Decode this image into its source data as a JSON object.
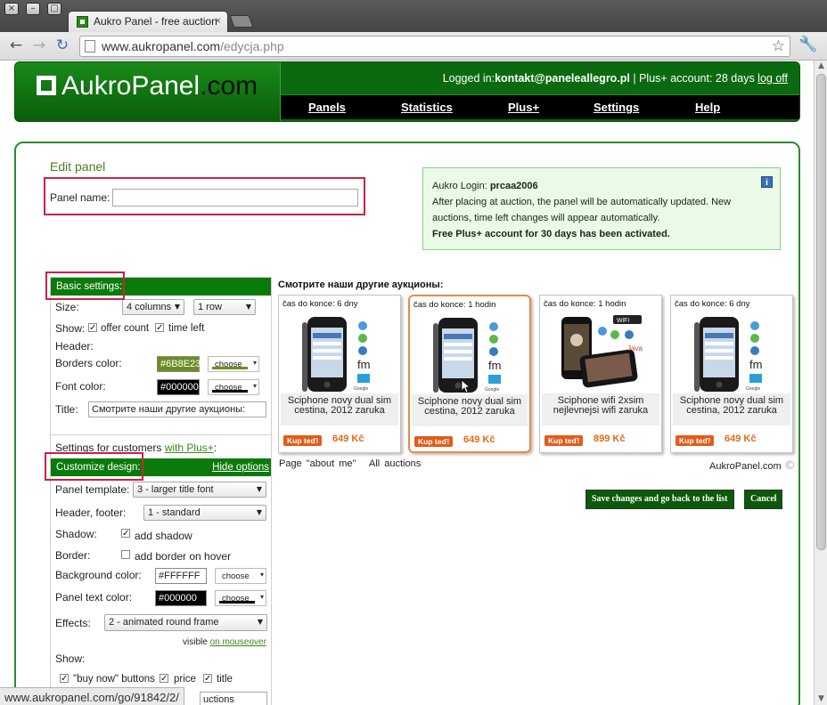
{
  "browser": {
    "tab_title": "Aukro Panel - free auction",
    "tab_close": "×",
    "url_host": "www.aukropanel.com",
    "url_path": "/edycja.php",
    "window_buttons": [
      "×",
      "–",
      "□"
    ],
    "status_url": "www.aukropanel.com/go/91842/2/"
  },
  "header": {
    "logo_main": "AukroPanel",
    "logo_suffix": ".com",
    "logged_in_label": "Logged in:",
    "user_email": "kontakt@paneleallegro.pl",
    "plus_account": " | Plus+ account: 28 days ",
    "logout": "log off",
    "nav": [
      "Panels",
      "Statistics",
      "Plus+",
      "Settings",
      "Help"
    ]
  },
  "edit": {
    "title": "Edit panel",
    "panel_name_label": "Panel name:",
    "panel_name_value": ""
  },
  "info": {
    "login_label": "Aukro Login: ",
    "login_value": "prcaa2006",
    "text": "After placing at auction, the panel will be automatically updated. New auctions, time left changes will appear automatically.",
    "plus_text": "Free Plus+ account for 30 days has been activated."
  },
  "basic": {
    "header": "Basic settings:",
    "size_label": "Size:",
    "columns": "4 columns",
    "rows": "1 row",
    "show_label": "Show:",
    "offer_count": "offer count",
    "time_left": "time left",
    "header_label": "Header:",
    "borders_color_label": "Borders color:",
    "borders_color": "#6B8E23",
    "font_color_label": "Font color:",
    "font_color": "#000000",
    "choose": "choose",
    "title_label": "Title:",
    "title_value": "Смотрите наши другие аукционы:"
  },
  "plus": {
    "intro": "Settings for customers ",
    "intro_link": "with Plus+",
    "intro_end": ":",
    "header": "Customize design:",
    "hide_options": "Hide options",
    "template_label": "Panel template:",
    "template_value": "3 - larger title font",
    "header_footer_label": "Header, footer:",
    "header_footer_value": "1 - standard",
    "shadow_label": "Shadow:",
    "add_shadow": "add shadow",
    "border_label": "Border:",
    "add_border": "add border on hover",
    "bg_color_label": "Background color:",
    "bg_color": "#FFFFFF",
    "text_color_label": "Panel text color:",
    "text_color": "#000000",
    "effects_label": "Effects:",
    "effects_value": "2 - animated round frame",
    "visible_label": "visible ",
    "visible_link": "on mouseover",
    "show_label": "Show:",
    "buy_now": "\"buy now\" buttons",
    "price": "price",
    "title": "title",
    "bottom_field": "uctions"
  },
  "auctions": {
    "title": "Смотрите наши другие аукционы:",
    "buy_label": "Kup teď!",
    "items": [
      {
        "time": "čas do konce: 6 dny",
        "desc": "Sciphone novy dual sim cestina, 2012 zaruka",
        "price": "649 Kč"
      },
      {
        "time": "čas do konce: 1 hodin",
        "desc": "Sciphone novy dual sim cestina, 2012 zaruka",
        "price": "649 Kč"
      },
      {
        "time": "čas do konce: 1 hodin",
        "desc": "Sciphone wifi 2xsim nejlevnejsi wifi zaruka",
        "price": "899 Kč"
      },
      {
        "time": "čas do konce: 6 dny",
        "desc": "Sciphone novy dual sim cestina, 2012 zaruka",
        "price": "649 Kč"
      }
    ],
    "page_about": "Page \"about me\"",
    "all_auctions": "All auctions",
    "copyright": "AukroPanel.com",
    "copyright_symbol": "©"
  },
  "actions": {
    "save": "Save changes and go back to the list",
    "cancel": "Cancel"
  },
  "colors": {
    "brand_green": "#0b6a10",
    "accent_red_box": "#cc2244",
    "price_orange": "#e26a1a"
  }
}
